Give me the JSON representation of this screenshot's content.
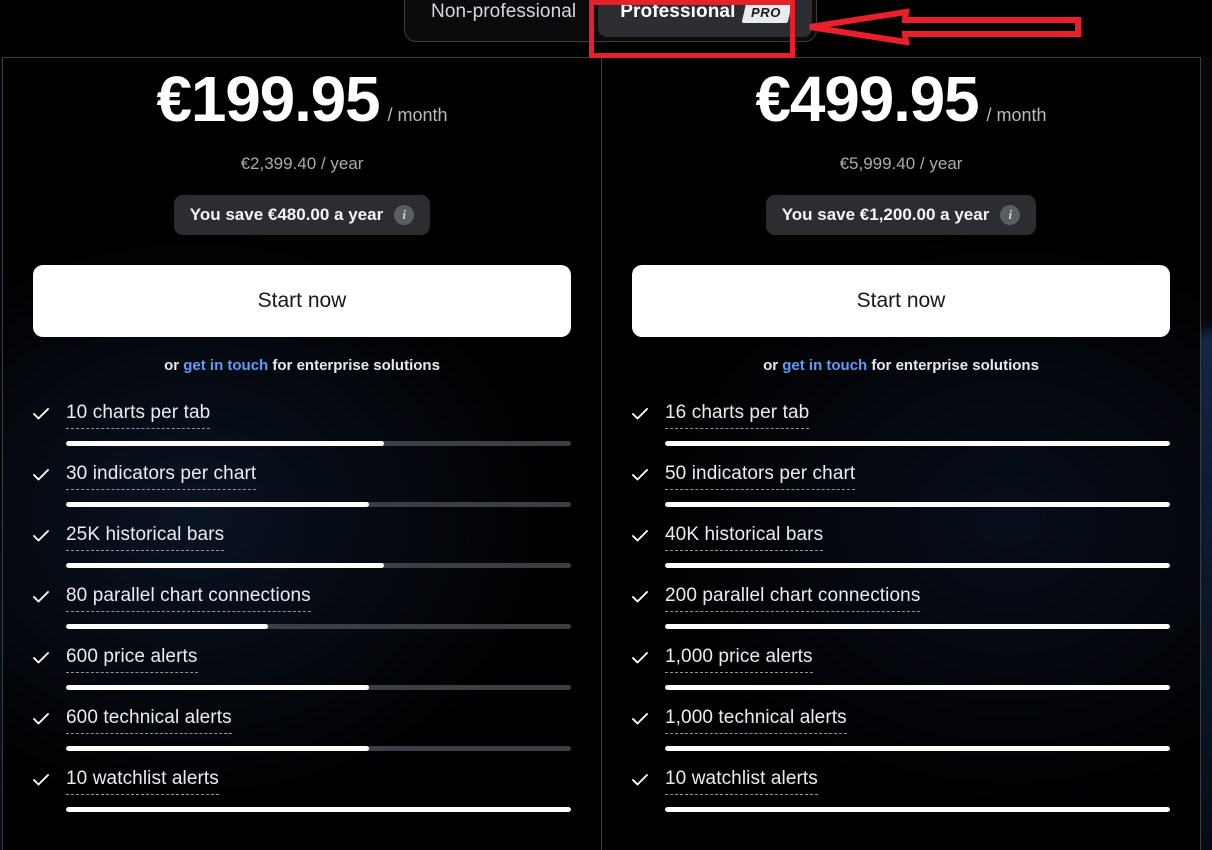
{
  "colors": {
    "accent_link": "#5b9df9",
    "annotation_red": "#e8202a",
    "cta_bg": "#ffffff",
    "bar_fill": "#ffffff",
    "bar_track": "#3b3e43",
    "card_bg": "#000000"
  },
  "toggle": {
    "options": [
      {
        "label": "Non-professional",
        "badge": null,
        "active": false
      },
      {
        "label": "Professional",
        "badge": "PRO",
        "active": true
      }
    ]
  },
  "plans": [
    {
      "price": "€199.95",
      "period": "/ month",
      "yearly": "€2,399.40 / year",
      "save": "You save €480.00 a year",
      "info_icon": "info-icon",
      "cta": "Start now",
      "enterprise_prefix": "or ",
      "enterprise_link": "get in touch",
      "enterprise_suffix": " for enterprise solutions",
      "features": [
        {
          "label": "10 charts per tab",
          "fill": 63
        },
        {
          "label": "30 indicators per chart",
          "fill": 60
        },
        {
          "label": "25K historical bars",
          "fill": 63
        },
        {
          "label": "80 parallel chart connections",
          "fill": 40
        },
        {
          "label": "600 price alerts",
          "fill": 60
        },
        {
          "label": "600 technical alerts",
          "fill": 60
        },
        {
          "label": "10 watchlist alerts",
          "fill": 100
        }
      ]
    },
    {
      "price": "€499.95",
      "period": "/ month",
      "yearly": "€5,999.40 / year",
      "save": "You save €1,200.00 a year",
      "info_icon": "info-icon",
      "cta": "Start now",
      "enterprise_prefix": "or ",
      "enterprise_link": "get in touch",
      "enterprise_suffix": " for enterprise solutions",
      "features": [
        {
          "label": "16 charts per tab",
          "fill": 100
        },
        {
          "label": "50 indicators per chart",
          "fill": 100
        },
        {
          "label": "40K historical bars",
          "fill": 100
        },
        {
          "label": "200 parallel chart connections",
          "fill": 100
        },
        {
          "label": "1,000 price alerts",
          "fill": 100
        },
        {
          "label": "1,000 technical alerts",
          "fill": 100
        },
        {
          "label": "10 watchlist alerts",
          "fill": 100
        }
      ]
    }
  ],
  "annotations": {
    "highlight_target": "Professional",
    "arrow_direction": "left",
    "box_color": "#e8202a",
    "arrow_color": "#e8202a"
  }
}
